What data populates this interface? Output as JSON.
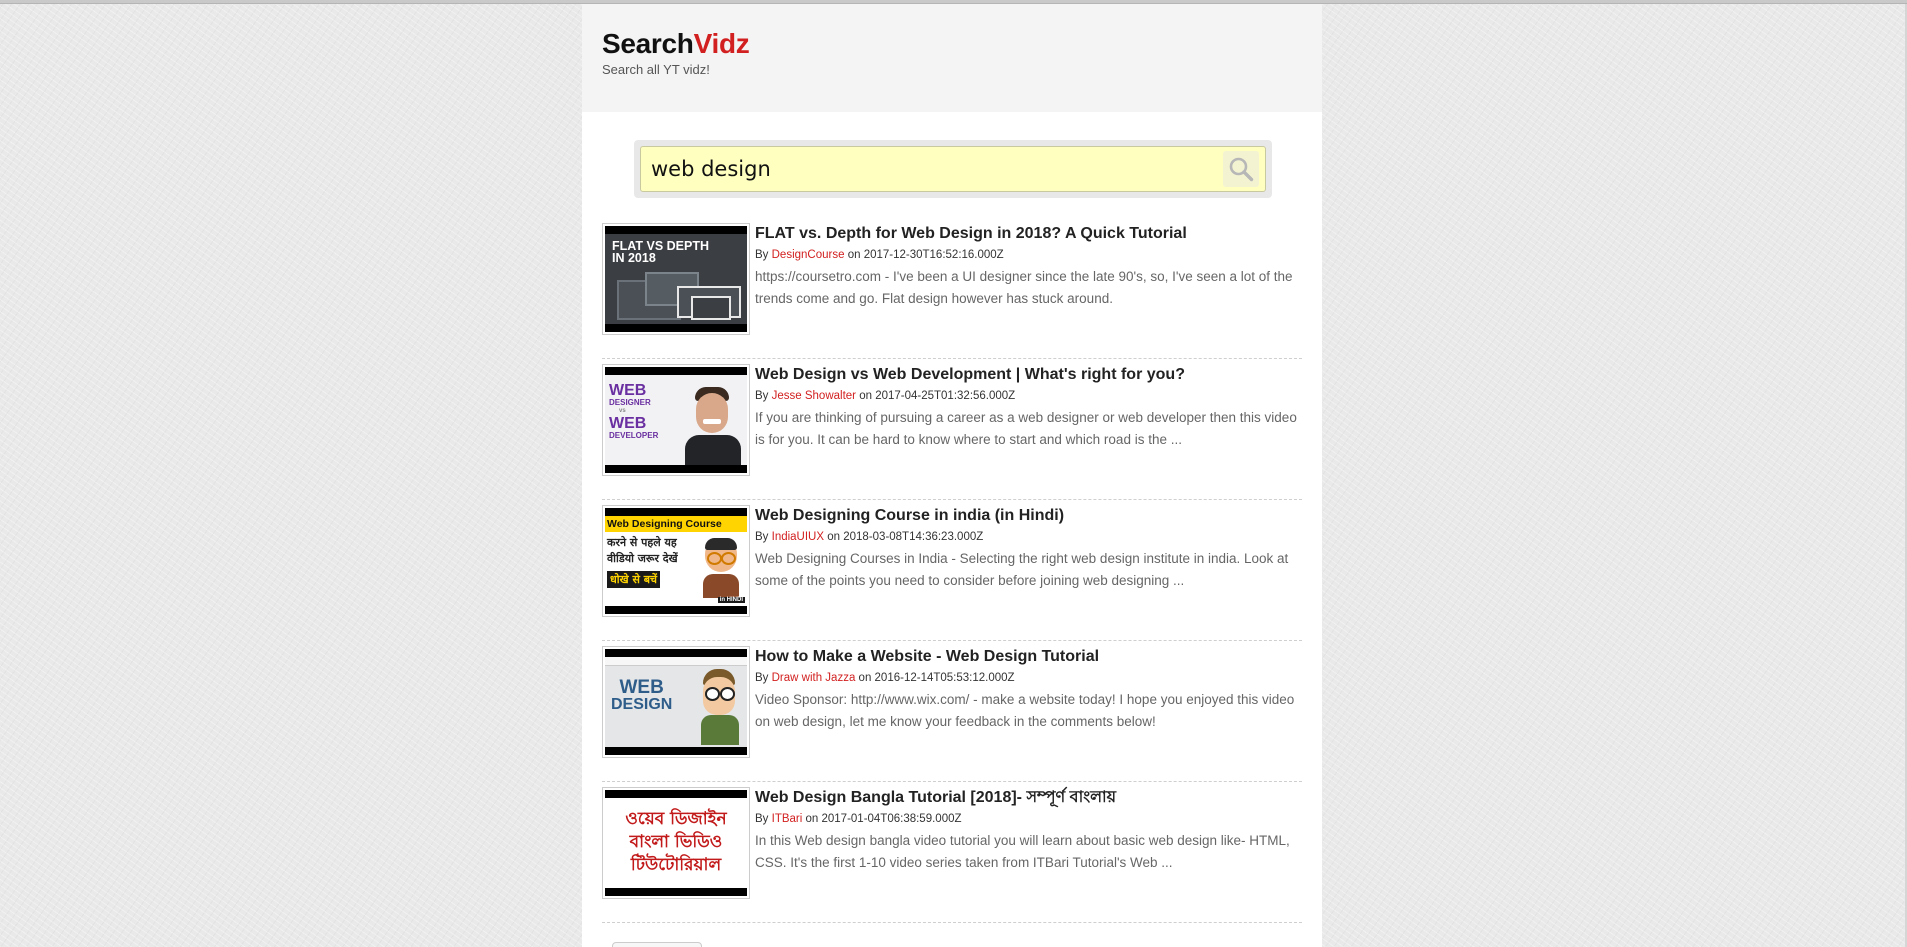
{
  "site": {
    "logo_part1": "Search",
    "logo_part2": "Vidz",
    "tagline": "Search all YT vidz!"
  },
  "search": {
    "value": "web design",
    "button_icon": "search-icon"
  },
  "results": [
    {
      "title": "FLAT vs. Depth for Web Design in 2018? A Quick Tutorial",
      "by": "By",
      "author": "DesignCourse",
      "on": "on 2017-12-30T16:52:16.000Z",
      "description": "https://coursetro.com - I've been a UI designer since the late 90's, so, I've seen a lot of the trends come and go. Flat design however has stuck around.",
      "thumb_text_1": "FLAT VS DEPTH",
      "thumb_text_2": "IN 2018"
    },
    {
      "title": "Web Design vs Web Development | What's right for you?",
      "by": "By",
      "author": "Jesse Showalter",
      "on": "on 2017-04-25T01:32:56.000Z",
      "description": "If you are thinking of pursuing a career as a web designer or web developer then this video is for you. It can be hard to know where to start and which road is the ...",
      "thumb_text_1": "WEB",
      "thumb_text_2": "DESIGNER",
      "thumb_text_3": "vs",
      "thumb_text_4": "WEB",
      "thumb_text_5": "DEVELOPER"
    },
    {
      "title": "Web Designing Course in india (in Hindi)",
      "by": "By",
      "author": "IndiaUIUX",
      "on": "on 2018-03-08T14:36:23.000Z",
      "description": "Web Designing Courses in India - Selecting the right web design institute in india. Look at some of the points you need to consider before joining web designing ...",
      "thumb_text_1": "Web Designing Course",
      "thumb_text_2": "करने से पहले यह",
      "thumb_text_3": "वीडियो जरूर देखें",
      "thumb_text_4": "धोखे से बचें",
      "thumb_text_5": "in HINDI"
    },
    {
      "title": "How to Make a Website - Web Design Tutorial",
      "by": "By",
      "author": "Draw with Jazza",
      "on": "on 2016-12-14T05:53:12.000Z",
      "description": "Video Sponsor: http://www.wix.com/ - make a website today! I hope you enjoyed this video on web design, let me know your feedback in the comments below!",
      "thumb_text_1": "WEB",
      "thumb_text_2": "DESIGN"
    },
    {
      "title": "Web Design Bangla Tutorial [2018]- সম্পূর্ণ বাংলায়",
      "by": "By",
      "author": "ITBari",
      "on": "on 2017-01-04T06:38:59.000Z",
      "description": "In this Web design bangla video tutorial you will learn about basic web design like- HTML, CSS. It's the first 1-10 video series taken from ITBari Tutorial's Web ...",
      "thumb_text_1": "ওয়েব ডিজাইন",
      "thumb_text_2": "বাংলা ভিডিও",
      "thumb_text_3": "টিউটোরিয়াল"
    }
  ],
  "colors": {
    "accent": "#d21f1f",
    "search_bg": "#ffffc0",
    "header_bg": "#f4f4f4"
  }
}
